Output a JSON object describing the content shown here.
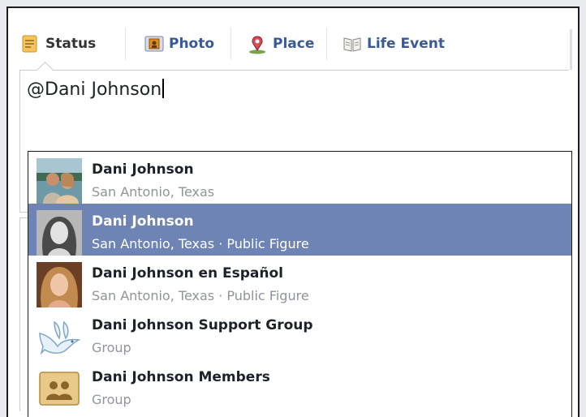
{
  "tabs": [
    {
      "label": "Status",
      "icon": "status-icon"
    },
    {
      "label": "Photo",
      "icon": "photo-icon"
    },
    {
      "label": "Place",
      "icon": "place-icon"
    },
    {
      "label": "Life Event",
      "icon": "life-event-icon"
    }
  ],
  "composer": {
    "value": "@Dani Johnson"
  },
  "suggestions": [
    {
      "name": "Dani Johnson",
      "subtitle": "San Antonio, Texas",
      "selected": false,
      "thumb": "couple-photo"
    },
    {
      "name": "Dani Johnson",
      "subtitle": "San Antonio, Texas · Public Figure",
      "selected": true,
      "thumb": "portrait-bw"
    },
    {
      "name": "Dani Johnson en Español",
      "subtitle": "San Antonio, Texas · Public Figure",
      "selected": false,
      "thumb": "portrait-color"
    },
    {
      "name": "Dani Johnson Support Group",
      "subtitle": "Group",
      "selected": false,
      "thumb": "dove-icon"
    },
    {
      "name": "Dani Johnson Members",
      "subtitle": "Group",
      "selected": false,
      "thumb": "group-icon"
    }
  ],
  "colors": {
    "link": "#3b5998",
    "selection": "#6d84b4",
    "secondary_text": "#90949c"
  }
}
